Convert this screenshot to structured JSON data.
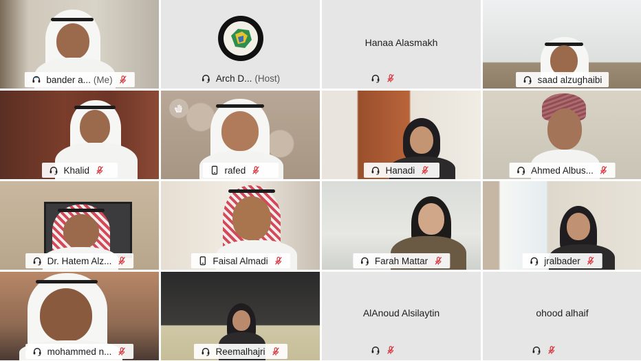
{
  "participants": [
    {
      "name": "bander a...",
      "tag": "(Me)"
    },
    {
      "name": "Arch D...",
      "tag": "(Host)"
    },
    {
      "name": "Hanaa Alasmakh"
    },
    {
      "name": "saad alzughaibi"
    },
    {
      "name": "Khalid"
    },
    {
      "name": "rafed"
    },
    {
      "name": "Hanadi"
    },
    {
      "name": "Ahmed Albus..."
    },
    {
      "name": "Dr. Hatem Alz..."
    },
    {
      "name": "Faisal Almadi"
    },
    {
      "name": "Farah Mattar"
    },
    {
      "name": "jralbader"
    },
    {
      "name": "mohammed n..."
    },
    {
      "name": "Reemalhajri"
    },
    {
      "name": "AlAnoud Alsilaytin"
    },
    {
      "name": "ohood alhaif"
    }
  ],
  "colors": {
    "active_speaker_border": "#31a9db",
    "muted_mic": "#d9363e",
    "tile_background": "#e6e6e6"
  },
  "icons": {
    "audio": "headset-icon",
    "phone": "phone-icon",
    "mute": "mic-muted-icon",
    "raise_hand": "raise-hand-icon"
  }
}
